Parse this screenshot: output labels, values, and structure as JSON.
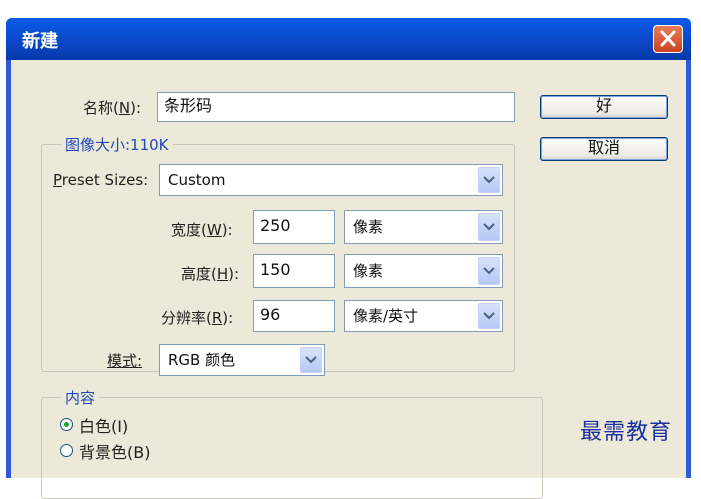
{
  "window": {
    "title": "新建"
  },
  "name_row": {
    "label": "名称(",
    "mnemonic": "N",
    "label_end": "):",
    "value": "条形码"
  },
  "buttons": {
    "ok": "好",
    "cancel": "取消"
  },
  "image_size": {
    "legend": "图像大小:110K",
    "preset": {
      "label_mn": "P",
      "label_rest": "reset Sizes:",
      "value": "Custom"
    },
    "width": {
      "label": "宽度(",
      "mnemonic": "W",
      "label_end": "):",
      "value": "250",
      "unit": "像素"
    },
    "height": {
      "label": "高度(",
      "mnemonic": "H",
      "label_end": "):",
      "value": "150",
      "unit": "像素"
    },
    "resolution": {
      "label": "分辨率(",
      "mnemonic": "R",
      "label_end": "):",
      "value": "96",
      "unit": "像素/英寸"
    },
    "mode": {
      "label": "模式:",
      "value": "RGB 颜色"
    }
  },
  "contents": {
    "legend": "内容",
    "options": [
      {
        "label": "白色(I)",
        "selected": true
      },
      {
        "label": "背景色(B)",
        "selected": false
      }
    ]
  },
  "watermark": "最需教育",
  "colors": {
    "title_bar": "#0b48c8",
    "dialog_bg": "#ece9d8",
    "accent": "#1f49b6"
  }
}
